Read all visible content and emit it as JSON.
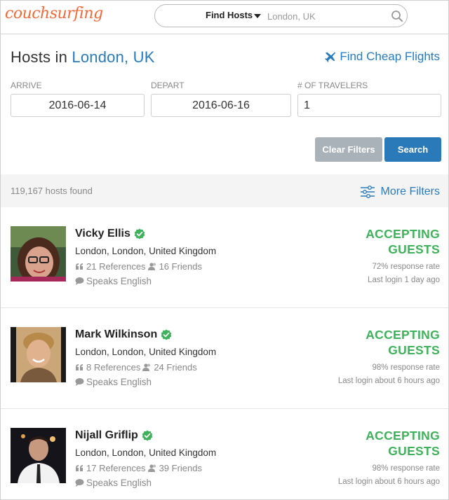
{
  "header": {
    "logo": "couchsurfing",
    "search_mode": "Find Hosts",
    "location_placeholder": "London, UK"
  },
  "page": {
    "title_prefix": "Hosts in",
    "title_city": "London, UK",
    "flights_link": "Find Cheap Flights"
  },
  "filters": {
    "arrive_label": "ARRIVE",
    "arrive_value": "2016-06-14",
    "depart_label": "DEPART",
    "depart_value": "2016-06-16",
    "travelers_label": "# OF TRAVELERS",
    "travelers_value": "1",
    "clear_label": "Clear Filters",
    "search_label": "Search"
  },
  "results": {
    "count": "119,167 hosts found",
    "more_filters": "More Filters"
  },
  "colors": {
    "brand_orange": "#ed6b3b",
    "link_blue": "#2a7ab9",
    "accept_green": "#3fb15a"
  },
  "hosts": [
    {
      "name": "Vicky Ellis",
      "location": "London, London, United Kingdom",
      "references": "21 References",
      "friends": "16 Friends",
      "speaks": "Speaks English",
      "status_line1": "ACCEPTING",
      "status_line2": "GUESTS",
      "response_rate": "72% response rate",
      "last_login": "Last login 1 day ago"
    },
    {
      "name": "Mark Wilkinson",
      "location": "London, London, United Kingdom",
      "references": "8 References",
      "friends": "24 Friends",
      "speaks": "Speaks English",
      "status_line1": "ACCEPTING",
      "status_line2": "GUESTS",
      "response_rate": "98% response rate",
      "last_login": "Last login about 6 hours ago"
    },
    {
      "name": "Nijall Griflip",
      "location": "London, London, United Kingdom",
      "references": "17 References",
      "friends": "39 Friends",
      "speaks": "Speaks English",
      "status_line1": "ACCEPTING",
      "status_line2": "GUESTS",
      "response_rate": "98% response rate",
      "last_login": "Last login about 6 hours ago"
    }
  ]
}
